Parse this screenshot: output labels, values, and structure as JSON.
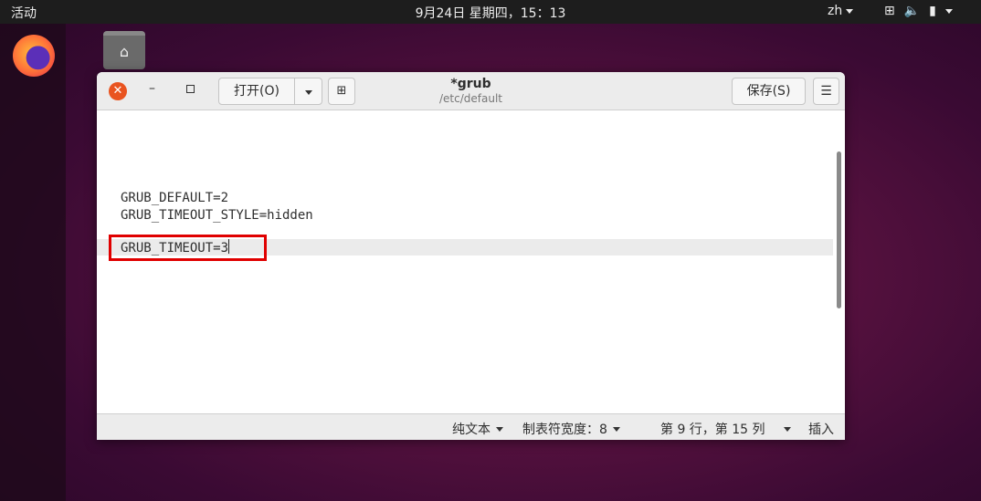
{
  "topbar": {
    "activities": "活动",
    "clock": "9月24日 星期四，15：13",
    "lang": "zh"
  },
  "window": {
    "title": "*grub",
    "subtitle": "/etc/default",
    "open_label": "打开(O)",
    "save_label": "保存(S)"
  },
  "editor": {
    "lines": [
      "GRUB_DEFAULT=2",
      "GRUB_TIMEOUT_STYLE=hidden",
      "GRUB_TIMEOUT=3"
    ]
  },
  "statusbar": {
    "syntax": "纯文本",
    "tab_width": "制表符宽度：8",
    "position": "第 9 行，第 15 列",
    "insert_mode": "插入"
  },
  "colors": {
    "accent": "#e95420",
    "highlight": "#e00000"
  },
  "icons": [
    "firefox-icon",
    "home-folder-icon",
    "network-icon",
    "volume-icon",
    "battery-icon",
    "close-icon",
    "minimize-icon",
    "maximize-icon",
    "new-document-icon",
    "hamburger-menu-icon"
  ]
}
